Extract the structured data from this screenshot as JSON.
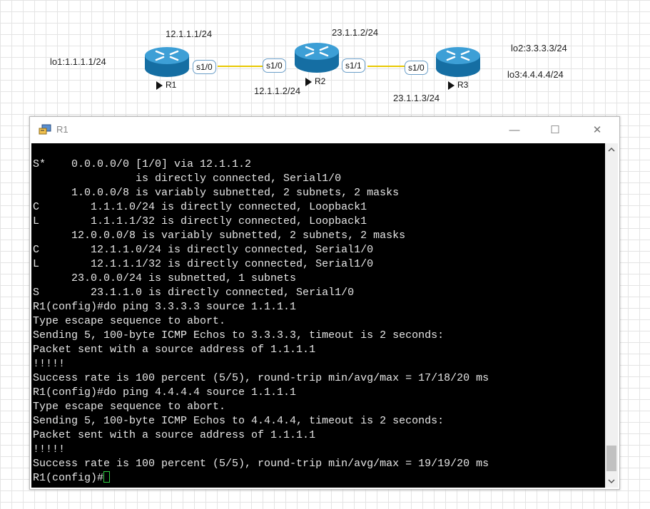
{
  "topology": {
    "labels": {
      "r1_s1_0_ip": "12.1.1.1/24",
      "r1_lo1": "lo1:1.1.1.1/24",
      "r2_s1_1_ip": "23.1.1.2/24",
      "r2_s1_0_ip": "12.1.1.2/24",
      "r3_s1_0_ip": "23.1.1.3/24",
      "r3_lo2": "lo2:3.3.3.3/24",
      "r3_lo3": "lo3:4.4.4.4/24"
    },
    "routers": {
      "r1": "R1",
      "r2": "R2",
      "r3": "R3"
    },
    "ports": {
      "r1_s1_0": "s1/0",
      "r2_s1_0": "s1/0",
      "r2_s1_1": "s1/1",
      "r3_s1_0": "s1/0"
    },
    "link_color": "#e8c800"
  },
  "window": {
    "title": "R1",
    "minimize": "—",
    "maximize": "☐",
    "close": "✕"
  },
  "console": {
    "lines": [
      "S*    0.0.0.0/0 [1/0] via 12.1.1.2",
      "                is directly connected, Serial1/0",
      "      1.0.0.0/8 is variably subnetted, 2 subnets, 2 masks",
      "C        1.1.1.0/24 is directly connected, Loopback1",
      "L        1.1.1.1/32 is directly connected, Loopback1",
      "      12.0.0.0/8 is variably subnetted, 2 subnets, 2 masks",
      "C        12.1.1.0/24 is directly connected, Serial1/0",
      "L        12.1.1.1/32 is directly connected, Serial1/0",
      "      23.0.0.0/24 is subnetted, 1 subnets",
      "S        23.1.1.0 is directly connected, Serial1/0",
      "R1(config)#do ping 3.3.3.3 source 1.1.1.1",
      "Type escape sequence to abort.",
      "Sending 5, 100-byte ICMP Echos to 3.3.3.3, timeout is 2 seconds:",
      "Packet sent with a source address of 1.1.1.1",
      "!!!!!",
      "Success rate is 100 percent (5/5), round-trip min/avg/max = 17/18/20 ms",
      "R1(config)#do ping 4.4.4.4 source 1.1.1.1",
      "Type escape sequence to abort.",
      "Sending 5, 100-byte ICMP Echos to 4.4.4.4, timeout is 2 seconds:",
      "Packet sent with a source address of 1.1.1.1",
      "!!!!!",
      "Success rate is 100 percent (5/5), round-trip min/avg/max = 19/19/20 ms"
    ],
    "prompt": "R1(config)#",
    "text_color": "#e6e6e6",
    "background": "#000000",
    "cursor_color": "#2ecc40"
  }
}
